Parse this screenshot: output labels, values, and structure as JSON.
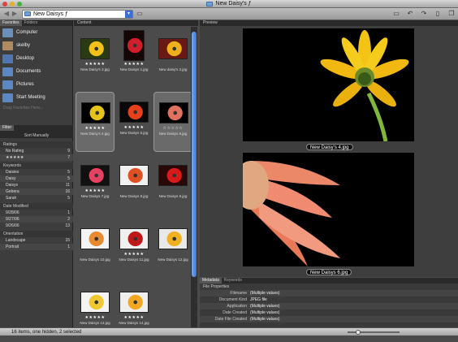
{
  "window": {
    "title": "New Daisy's ƒ"
  },
  "toolbar": {
    "path": "New Daisys ƒ",
    "icons": [
      "back-arrow-icon",
      "forward-arrow-icon",
      "folder-icon",
      "new-folder-icon",
      "rotate-left-icon",
      "rotate-right-icon",
      "delete-icon",
      "compact-mode-icon"
    ]
  },
  "left": {
    "tabs": [
      "Favorites",
      "Folders"
    ],
    "favorites": [
      {
        "label": "Computer",
        "color": "#6a8fb8"
      },
      {
        "label": "skelby",
        "color": "#b08a60"
      },
      {
        "label": "Desktop",
        "color": "#4f76b0"
      },
      {
        "label": "Documents",
        "color": "#5d86c4"
      },
      {
        "label": "Pictures",
        "color": "#5d86c4"
      },
      {
        "label": "Start Meeting",
        "color": "#5d86c4"
      }
    ],
    "fav_hint": "Drag Favorites Here...",
    "filter_tab": "Filter",
    "sort": "Sort Manually",
    "sections": [
      {
        "title": "Ratings",
        "rows": [
          {
            "k": "No Rating",
            "v": "9"
          },
          {
            "k": "★★★★★",
            "v": "7"
          }
        ]
      },
      {
        "title": "Keywords",
        "rows": [
          {
            "k": "Daisies",
            "v": "5"
          },
          {
            "k": "Daisy",
            "v": "5"
          },
          {
            "k": "Daisys",
            "v": "11"
          },
          {
            "k": "Gebera",
            "v": "16"
          },
          {
            "k": "Sarah",
            "v": "5"
          }
        ]
      },
      {
        "title": "Date Modified",
        "rows": [
          {
            "k": "9/28/06",
            "v": "1"
          },
          {
            "k": "9/27/06",
            "v": "2"
          },
          {
            "k": "9/26/06",
            "v": "13"
          }
        ]
      },
      {
        "title": "Orientation",
        "rows": [
          {
            "k": "Landscape",
            "v": "15"
          },
          {
            "k": "Portrait",
            "v": "1"
          }
        ]
      }
    ]
  },
  "content": {
    "tab": "Content",
    "items": [
      {
        "name": "New Daisy's 3.jpg",
        "stars": "★★★★★",
        "bg": "#2a3a12",
        "fg": "#f2c21a",
        "tall": false
      },
      {
        "name": "New Daisys 1.jpg",
        "stars": "★★★★★",
        "bg": "#150606",
        "fg": "#d41d2a",
        "tall": true
      },
      {
        "name": "New daisy's 2.jpg",
        "stars": "",
        "bg": "#6a1a12",
        "fg": "#f0b01a",
        "tall": false
      },
      {
        "name": "New Daisy's 4.jpg",
        "stars": "★★★★★",
        "bg": "#000",
        "fg": "#e6c21c",
        "tall": false
      },
      {
        "name": "New Daisys 5.jpg",
        "stars": "★★★★★",
        "bg": "#080808",
        "fg": "#e8401a",
        "tall": false
      },
      {
        "name": "New Daisys 6.jpg",
        "stars": "☆☆☆☆☆",
        "bg": "#000",
        "fg": "#e07060",
        "tall": false
      },
      {
        "name": "New Daisys 7.jpg",
        "stars": "★★★★★",
        "bg": "#111",
        "fg": "#e84060",
        "tall": false
      },
      {
        "name": "New Daisys 8.jpg",
        "stars": "",
        "bg": "#f0f0f0",
        "fg": "#e05020",
        "tall": false
      },
      {
        "name": "New Daisys 9.jpg",
        "stars": "",
        "bg": "#2a0808",
        "fg": "#d81c1c",
        "tall": false
      },
      {
        "name": "New Daisys 10.jpg",
        "stars": "",
        "bg": "#f4f4f4",
        "fg": "#e88a30",
        "tall": false
      },
      {
        "name": "New Daisys 11.jpg",
        "stars": "★★★★★",
        "bg": "#f0f0f0",
        "fg": "#c01818",
        "tall": false
      },
      {
        "name": "New Daisys 12.jpg",
        "stars": "",
        "bg": "#e8e8e8",
        "fg": "#f0b020",
        "tall": false
      },
      {
        "name": "New Daisys 13.jpg",
        "stars": "★★★★★",
        "bg": "#f4f4f4",
        "fg": "#f2c830",
        "tall": false
      },
      {
        "name": "New Daisys 14.jpg",
        "stars": "★★★★★",
        "bg": "#efefef",
        "fg": "#f0a820",
        "tall": false
      }
    ]
  },
  "preview": {
    "tab": "Preview",
    "images": [
      {
        "label": "New Daisy's 4.jpg"
      },
      {
        "label": "New Daisys 6.jpg"
      }
    ]
  },
  "metadata": {
    "tabs": [
      "Metadata",
      "Keywords"
    ],
    "section": "File Properties",
    "rows": [
      {
        "k": "Filename",
        "v": "(Multiple values)"
      },
      {
        "k": "Document Kind",
        "v": "JPEG file"
      },
      {
        "k": "Application",
        "v": "(Multiple values)"
      },
      {
        "k": "Date Created",
        "v": "(Multiple values)"
      },
      {
        "k": "Date File Created",
        "v": "(Multiple values)"
      }
    ]
  },
  "status": {
    "text": "16 items, one hidden, 2 selected"
  }
}
